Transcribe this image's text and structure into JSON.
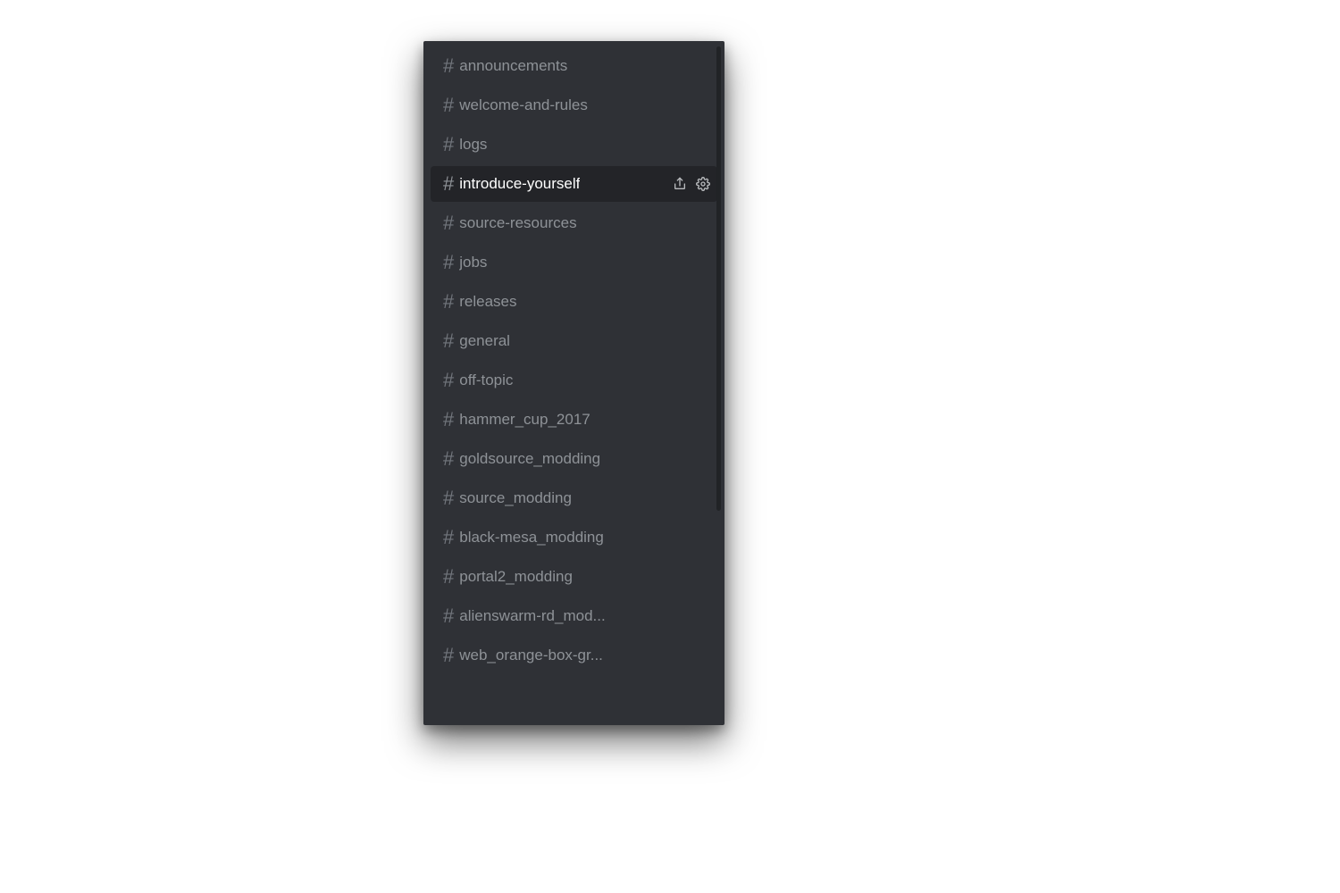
{
  "channels": [
    {
      "name": "announcements",
      "selected": false
    },
    {
      "name": "welcome-and-rules",
      "selected": false
    },
    {
      "name": "logs",
      "selected": false
    },
    {
      "name": "introduce-yourself",
      "selected": true
    },
    {
      "name": "source-resources",
      "selected": false
    },
    {
      "name": "jobs",
      "selected": false
    },
    {
      "name": "releases",
      "selected": false
    },
    {
      "name": "general",
      "selected": false
    },
    {
      "name": "off-topic",
      "selected": false
    },
    {
      "name": "hammer_cup_2017",
      "selected": false
    },
    {
      "name": "goldsource_modding",
      "selected": false
    },
    {
      "name": "source_modding",
      "selected": false
    },
    {
      "name": "black-mesa_modding",
      "selected": false
    },
    {
      "name": "portal2_modding",
      "selected": false
    },
    {
      "name": "alienswarm-rd_mod...",
      "selected": false
    },
    {
      "name": "web_orange-box-gr...",
      "selected": false
    }
  ],
  "icons": {
    "invite_title": "Create Invite",
    "settings_title": "Edit Channel"
  },
  "hash_symbol": "#"
}
